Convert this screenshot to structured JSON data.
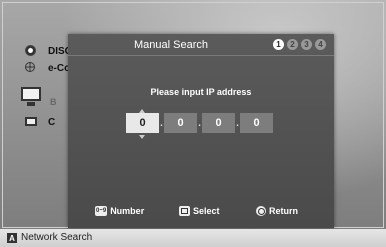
{
  "background_menu": {
    "disc_label": "DISC",
    "econtent_label": "e-Co",
    "pc1_label": "B",
    "pc2_label": "C"
  },
  "dialog": {
    "title": "Manual Search",
    "steps": [
      "1",
      "2",
      "3",
      "4"
    ],
    "active_step": "1",
    "prompt": "Please input IP address",
    "ip_octets": [
      "0",
      "0",
      "0",
      "0"
    ],
    "separator": "."
  },
  "footer": {
    "number_key": "0~9",
    "number_label": "Number",
    "select_label": "Select",
    "return_label": "Return"
  },
  "bottom_bar": {
    "key_label": "A",
    "label": "Network Search"
  },
  "colors": {
    "dialog_bg": "#4f4f4f",
    "active_field": "#e8e8e8",
    "inactive_field": "#7d7d7d"
  }
}
